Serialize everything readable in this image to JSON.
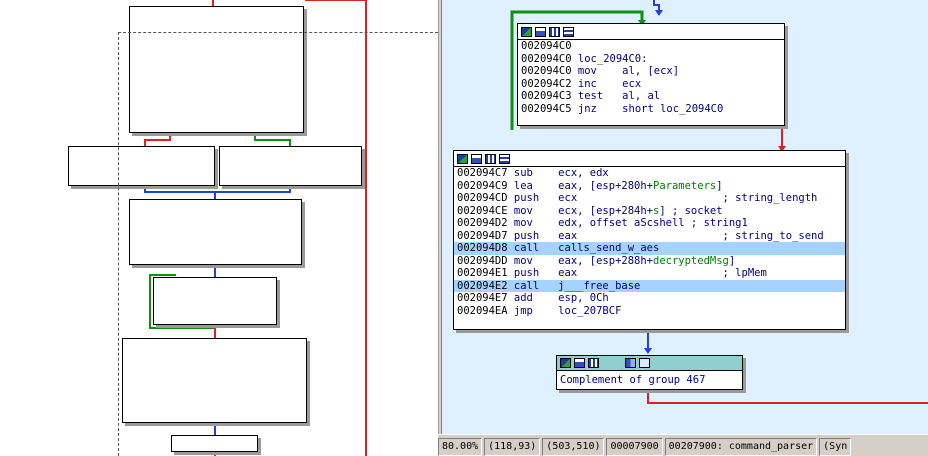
{
  "overview": {
    "nodes": [
      "node-1",
      "node-2",
      "node-3",
      "node-4",
      "node-5",
      "node-6",
      "node-7"
    ]
  },
  "loop_block": {
    "rows": [
      {
        "addr": "002094C0",
        "mn": "",
        "op": ""
      },
      {
        "addr": "002094C0",
        "mn": "loc_2094C0:",
        "op": ""
      },
      {
        "addr": "002094C0",
        "mn": "mov",
        "op": "al, [ecx]"
      },
      {
        "addr": "002094C2",
        "mn": "inc",
        "op": "ecx"
      },
      {
        "addr": "002094C3",
        "mn": "test",
        "op": "al, al"
      },
      {
        "addr": "002094C5",
        "mn": "jnz",
        "op": "short loc_2094C0"
      }
    ]
  },
  "main_block": {
    "rows": [
      {
        "addr": "002094C7",
        "mn": "sub",
        "op": "ecx, edx",
        "cm": ""
      },
      {
        "addr": "002094C9",
        "mn": "lea",
        "op": "eax, [esp+280h+",
        "var": "Parameters",
        "op2": "]",
        "cm": ""
      },
      {
        "addr": "002094CD",
        "mn": "push",
        "op": "ecx",
        "cm": "; string_length"
      },
      {
        "addr": "002094CE",
        "mn": "mov",
        "op": "ecx, [esp+284h+",
        "var": "s",
        "op2": "] ; socket",
        "cm": ""
      },
      {
        "addr": "002094D2",
        "mn": "mov",
        "op": "edx, offset aScshell ; string1",
        "cm": ""
      },
      {
        "addr": "002094D7",
        "mn": "push",
        "op": "eax",
        "cm": "; string_to_send"
      },
      {
        "addr": "002094D8",
        "mn": "call",
        "op": "calls_send_w_aes",
        "cm": "",
        "hl": true
      },
      {
        "addr": "002094DD",
        "mn": "mov",
        "op": "eax, [esp+288h+",
        "var": "decryptedMsg",
        "op2": "]",
        "cm": ""
      },
      {
        "addr": "002094E1",
        "mn": "push",
        "op": "eax",
        "cm": "; lpMem"
      },
      {
        "addr": "002094E2",
        "mn": "call",
        "op": "j___free_base",
        "cm": "",
        "hl": true
      },
      {
        "addr": "002094E7",
        "mn": "add",
        "op": "esp, 0Ch",
        "cm": ""
      },
      {
        "addr": "002094EA",
        "mn": "jmp",
        "op": "loc_207BCF",
        "cm": ""
      }
    ]
  },
  "group_block": {
    "label": "Complement of group 467"
  },
  "status": {
    "zoom": "80.00%",
    "mouse": "(118,93)",
    "graph": "(503,510)",
    "offset": "00007900",
    "location": "00207900: command_parser",
    "sync": "(Syn"
  },
  "colors": {
    "edge_red": "#e02020",
    "edge_green": "#109010",
    "edge_blue": "#2040e0",
    "highlight": "#a6d2ff",
    "graph_bg": "#dff0ff",
    "group_head": "#8fcfd0"
  }
}
